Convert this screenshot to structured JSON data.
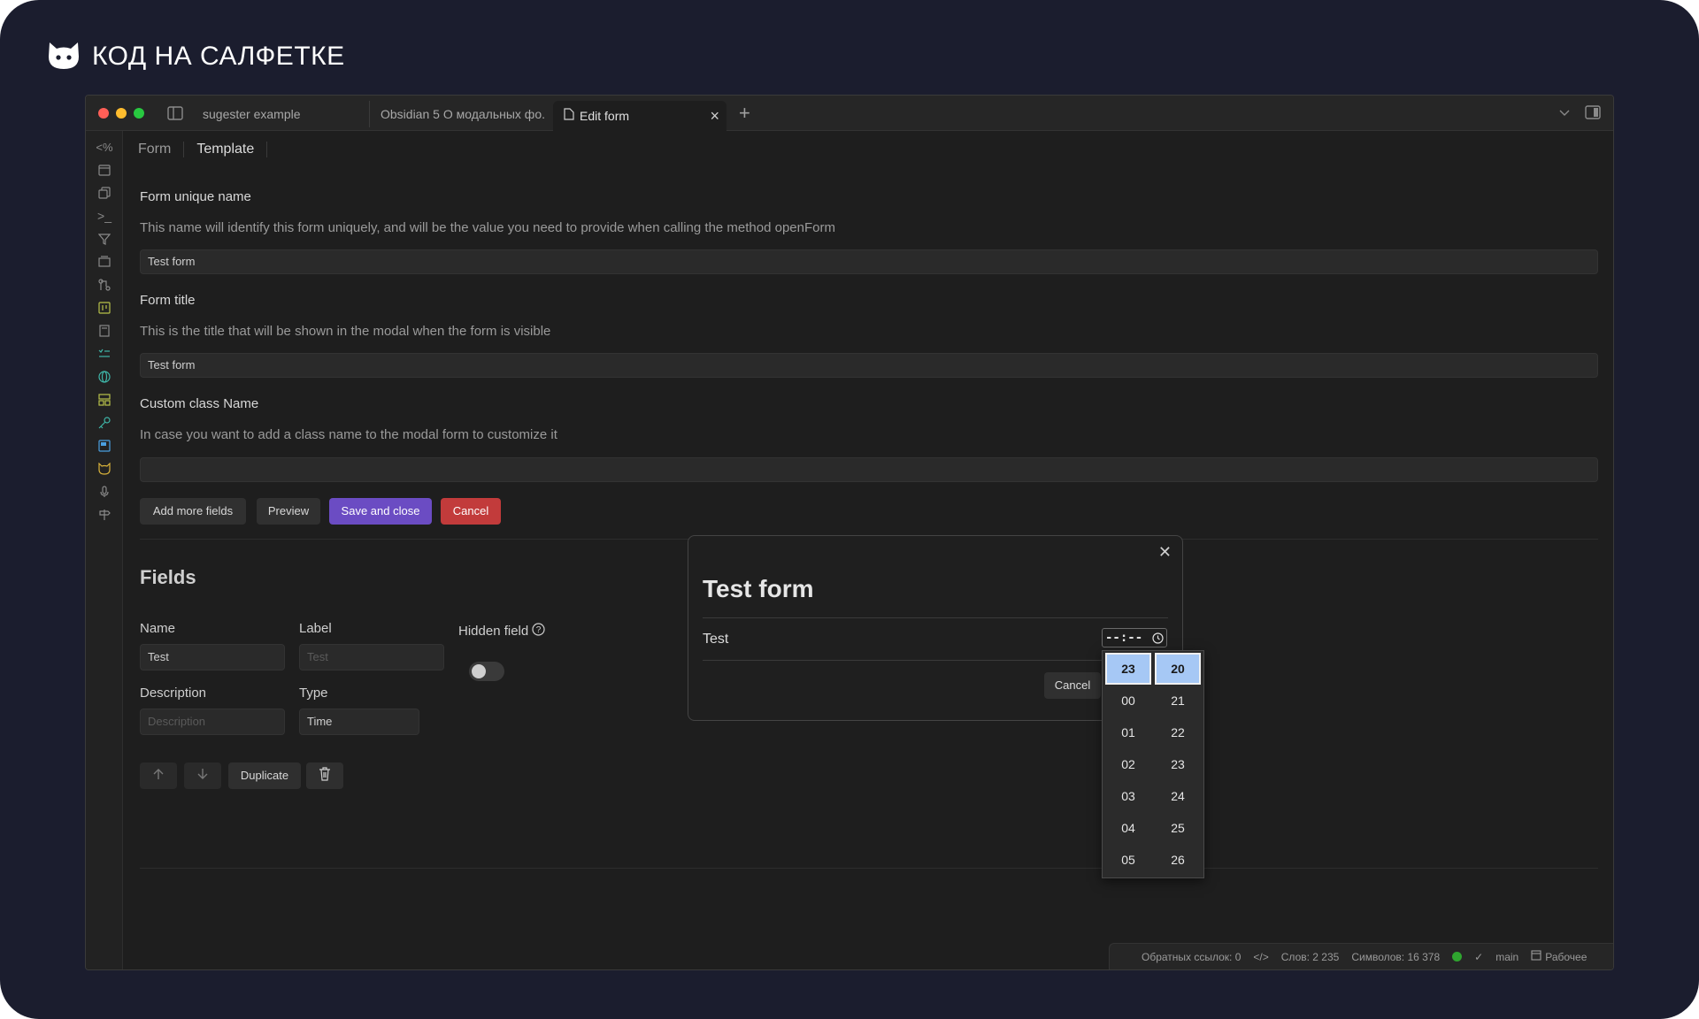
{
  "brand": {
    "text": "КОД НА САЛФЕТКЕ",
    "icon": "cat-icon",
    "color": "#ffffff"
  },
  "tabs": [
    {
      "label": "sugester example"
    },
    {
      "label": "Obsidian 5 О модальных фо..."
    },
    {
      "label": "Edit form",
      "active": true
    }
  ],
  "view_tabs": {
    "form": "Form",
    "template": "Template"
  },
  "form_unique_name": {
    "label": "Form unique name",
    "description": "This name will identify this form uniquely, and will be the value you need to provide when calling the method openForm",
    "value": "Test form"
  },
  "form_title": {
    "label": "Form title",
    "description": "This is the title that will be shown in the modal when the form is visible",
    "value": "Test form"
  },
  "custom_class": {
    "label": "Custom class Name",
    "description": "In case you want to add a class name to the modal form to customize it",
    "value": ""
  },
  "actions": {
    "add": "Add more fields",
    "preview": "Preview",
    "save": "Save and close",
    "cancel": "Cancel"
  },
  "fields_section": {
    "heading": "Fields",
    "name_label": "Name",
    "name_value": "Test",
    "label_label": "Label",
    "label_placeholder": "Test",
    "hidden_label": "Hidden field",
    "description_label": "Description",
    "description_placeholder": "Description",
    "type_label": "Type",
    "type_value": "Time",
    "duplicate": "Duplicate"
  },
  "status_bar": {
    "backlinks": "Обратных ссылок: 0",
    "words": "Слов: 2 235",
    "chars": "Символов: 16 378",
    "branch": "main",
    "workspace": "Рабочее"
  },
  "modal": {
    "title": "Test form",
    "field_label": "Test",
    "time_value": "--:--",
    "cancel": "Cancel"
  },
  "time_picker": {
    "hours": [
      "23",
      "00",
      "01",
      "02",
      "03",
      "04",
      "05"
    ],
    "minutes": [
      "20",
      "21",
      "22",
      "23",
      "24",
      "25",
      "26"
    ],
    "selected_hour": "23",
    "selected_minute": "20",
    "selection_color": "#a6c8f5"
  },
  "colors": {
    "accent": "#6b4cc3",
    "danger": "#c23b3b",
    "background": "#1b1d2e"
  }
}
